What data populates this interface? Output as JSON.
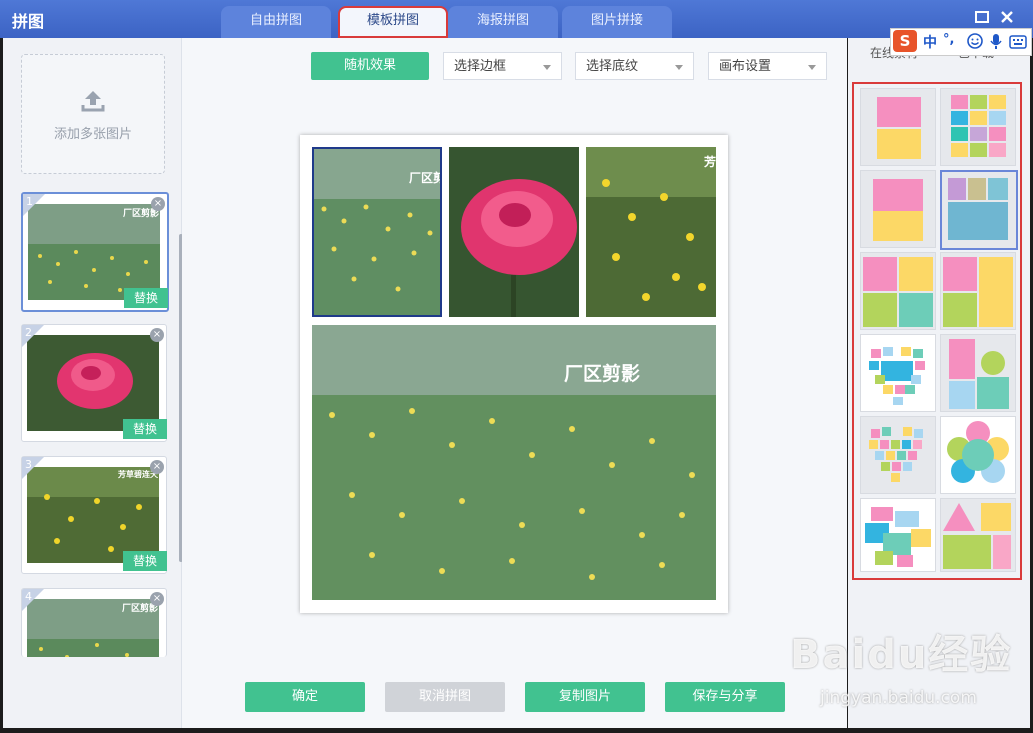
{
  "app": {
    "title": "拼图"
  },
  "tabs": [
    {
      "label": "自由拼图"
    },
    {
      "label": "模板拼图"
    },
    {
      "label": "海报拼图"
    },
    {
      "label": "图片拼接"
    }
  ],
  "left": {
    "add_label": "添加多张图片",
    "thumbs": [
      {
        "num": "1",
        "watermark": "厂区剪影",
        "replace": "替换"
      },
      {
        "num": "2",
        "replace": "替换"
      },
      {
        "num": "3",
        "watermark": "芳草碧连天",
        "replace": "替换"
      },
      {
        "num": "4",
        "watermark": "厂区剪影"
      }
    ]
  },
  "toolbar": {
    "random": "随机效果",
    "border": "选择边框",
    "texture": "选择底纹",
    "canvas": "画布设置"
  },
  "canvas": {
    "watermark_big": "厂区剪影",
    "watermark_small": "厂区剪",
    "watermark_right": "芳"
  },
  "bottom": {
    "ok": "确定",
    "cancel": "取消拼图",
    "copy": "复制图片",
    "save": "保存与分享"
  },
  "right": {
    "tab_online": "在线素材",
    "tab_download": "已下载"
  },
  "ime": {
    "logo": "S",
    "lang": "中",
    "punct": "°,"
  },
  "watermark": {
    "brand": "Baidu经验",
    "url": "jingyan.baidu.com"
  },
  "colors": {
    "accent": "#41c290",
    "titlebar": "#4a6fcf",
    "highlight": "#d93a3a"
  }
}
